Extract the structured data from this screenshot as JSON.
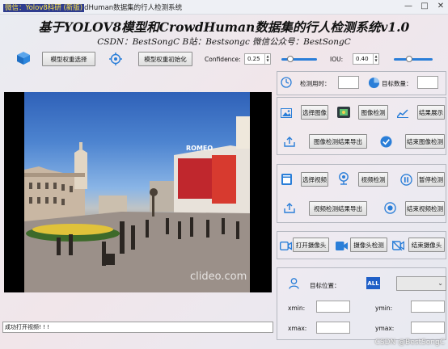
{
  "window": {
    "icon_text": "微信：Yolov8科研 (新版)",
    "title": "dHuman数据集的行人检测系统",
    "minimize": "—",
    "maximize": "□",
    "close": "✕"
  },
  "header": {
    "title": "基于YOLOV8模型和CrowdHuman数据集的行人检测系统v1.0",
    "subtitle": "CSDN：BestSongC   B站：Bestsongc   微信公众号：BestSongC"
  },
  "toolbar": {
    "model_select": "模型权重选择",
    "model_init": "模型权重初始化",
    "confidence_label": "Confidence:",
    "confidence_value": "0.25",
    "iou_label": "IOU:",
    "iou_value": "0.40",
    "confidence_level": 0.25,
    "iou_level": 0.4
  },
  "stats": {
    "time_label": "检测用时：",
    "count_label": "目标数量："
  },
  "image_section": {
    "select": "选择图像",
    "detect": "图像检测",
    "show": "结果展示",
    "export": "图像检测结果导出",
    "end": "结束图像检测"
  },
  "video_section": {
    "select": "选择视频",
    "detect": "视频检测",
    "pause": "暂停检测",
    "export": "视频检测结果导出",
    "end": "结束视频检测"
  },
  "camera_section": {
    "open": "打开摄像头",
    "detect": "摄像头检测",
    "close": "结束摄像头"
  },
  "target": {
    "position_label": "目标位置：",
    "all_badge": "ALL",
    "xmin": "xmin:",
    "ymin": "ymin:",
    "xmax": "xmax:",
    "ymax": "ymax:"
  },
  "preview": {
    "sign": "ROMEO",
    "clideo": "clideo.com"
  },
  "status": "成功打开视频! ! !",
  "watermark": "CSDN @BestSongC",
  "colors": {
    "accent_blue": "#2a7ed8",
    "title_highlight_bg": "#2f3d8f",
    "title_highlight_fg": "#ffe84a"
  }
}
